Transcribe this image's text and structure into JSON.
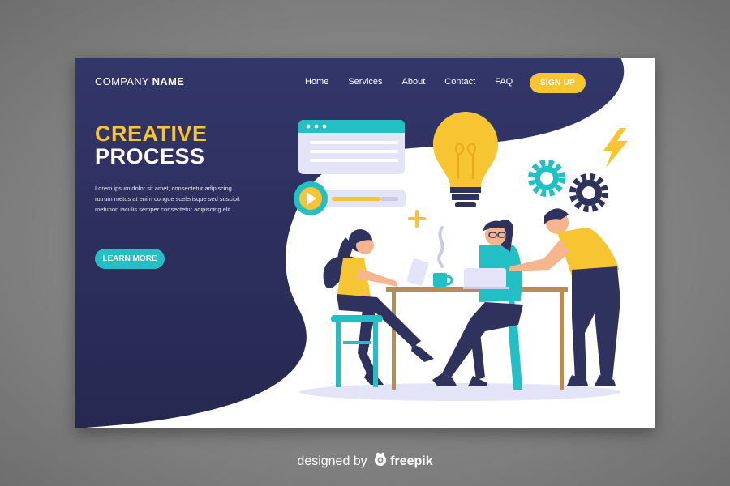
{
  "brand": {
    "prefix": "COMPANY",
    "emphasis": "NAME"
  },
  "nav": {
    "items": [
      {
        "label": "Home"
      },
      {
        "label": "Services"
      },
      {
        "label": "About"
      },
      {
        "label": "Contact"
      },
      {
        "label": "FAQ"
      }
    ],
    "signup_label": "SIGN UP"
  },
  "hero": {
    "title_line1": "CREATIVE",
    "title_line2": "PROCESS",
    "body_lines": [
      "Lorem ipsum dolor sit amet, consectetur adipiscing",
      "rutrum metus at enim congue scelerisque sed suscipit",
      "metunon iaculis semper consectetur adipiscing elit."
    ],
    "cta_label": "LEARN MORE"
  },
  "credit": {
    "prefix": "designed by",
    "brand": "freepik"
  },
  "colors": {
    "navy": "#2f325d",
    "yellow": "#f7c531",
    "teal": "#22bfc4",
    "lavender": "#e3e4f8"
  },
  "icons": [
    "browser-window-icon",
    "play-icon",
    "lightbulb-icon",
    "gear-icon",
    "lightning-icon",
    "plus-icon",
    "freepik-logo-icon"
  ]
}
